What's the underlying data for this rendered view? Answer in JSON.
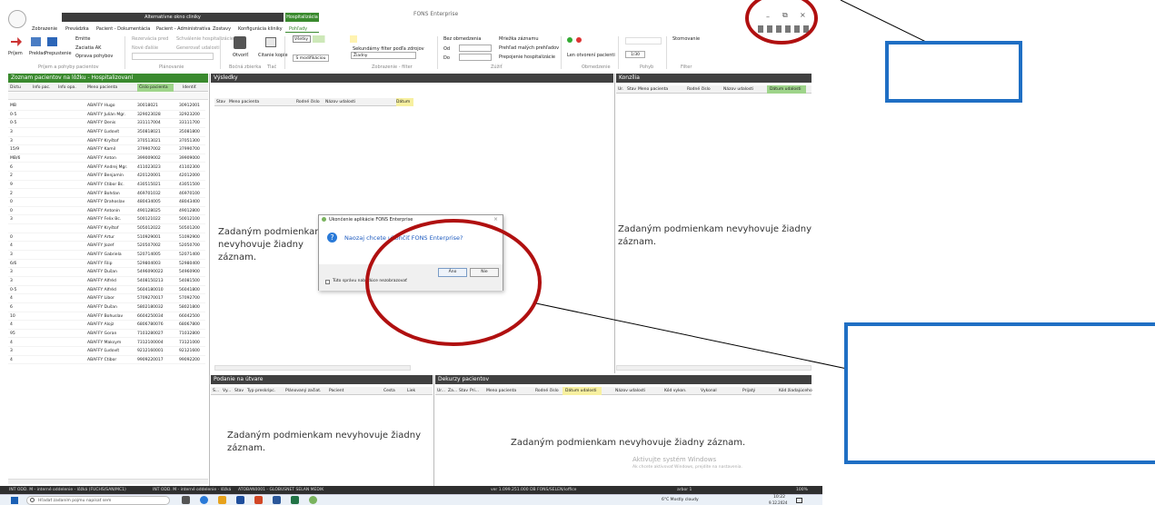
{
  "titlebar": {
    "context_tab": "Alternatívne okno cliniky",
    "contextual_group": "Hospitalizácia",
    "app_title": "FONS Enterprise"
  },
  "menu": [
    "Zobrazenie",
    "Prevádzka",
    "Pacient - Dokumentácia",
    "Pacient - Administratíva",
    "Zostavy",
    "Konfigurácia kliniky",
    "Pohľady"
  ],
  "ribbon": {
    "btns_left": [
      "Príjem",
      "Prekład",
      "Prepustenie"
    ],
    "btn_emitte": "Emitte",
    "btn_zaciatok": "Zaciatia AK",
    "btn_oprava": "Oprava pohybov",
    "grp_prijem": "Príjem a pohyby pacientov",
    "btn_rezervacia": "Rezervácia pred",
    "btn_nove_dalsie": "Nové ďalšie",
    "btn_schvalenie": "Schválenie hospitalizácie",
    "btn_generovat": "Generovať udalosti",
    "grp_planovanie": "Plánovanie",
    "btn_otvorit": "Otvoriť",
    "grp_bocna": "Bočná zbierka",
    "btn_tlacit": "Citanie kopie",
    "grp_tlac": "Tlač",
    "filter_vsetky": "Všetky",
    "lbl_select_filter": "Sekundárny filter podľa zdrojov",
    "filter_zdroj": "Žiadny",
    "btn_modifikacie": "S modifikáciou",
    "grp_zobrazenie": "Zobrazenie - filter",
    "lbl_bez_obmedzenia": "Bez obmedzenia",
    "lbl_od": "Od",
    "lbl_do": "Do",
    "grp_zuzit": "Zúžiť",
    "lbl_mriezka": "Mriežka záznamu",
    "lbl_prehlad": "Prehľad malých prehľadov",
    "lbl_propojenie": "Prepojenie hospitalizácie",
    "lbl_len_otvorene": "Len otvorení pacienti",
    "grp_obmedzenia": "Obmedzenie",
    "page_counter": "1/30",
    "grp_pohyb": "Pohyb",
    "btn_stornovanie": "Stornovanie",
    "grp_filter": "Filter"
  },
  "left_panel": {
    "title": "Zoznam pacientov na lôžku - Hospitalizovaní",
    "columns": [
      "Dictu",
      "Info pac.",
      "Info opa.",
      "Meno pacienta",
      "Číslo pacienta",
      "Identif."
    ],
    "rows": [
      {
        "c0": "MB",
        "name": "ABAFFY Hugo",
        "id": "30018021",
        "id2": "30912001"
      },
      {
        "c0": "0-5",
        "name": "ABAFFY Julián Mgr.",
        "id": "329023028",
        "id2": "32923200"
      },
      {
        "c0": "0-5",
        "name": "ABAFFY Denis",
        "id": "331117004",
        "id2": "33111700"
      },
      {
        "c0": "3",
        "name": "ABAFFY Ľudovít",
        "id": "350818021",
        "id2": "35081800"
      },
      {
        "c0": "3",
        "name": "ABAFFY Kryštof",
        "id": "370513021",
        "id2": "37051300"
      },
      {
        "c0": "15/9",
        "name": "ABAFFY Kamil",
        "id": "379907002",
        "id2": "37990700"
      },
      {
        "c0": "MB/6",
        "name": "ABAFFY Anton",
        "id": "399009002",
        "id2": "39909000"
      },
      {
        "c0": "6",
        "name": "ABAFFY Andrej Mgr.",
        "id": "411023023",
        "id2": "41102300"
      },
      {
        "c0": "2",
        "name": "ABAFFY Benjamín",
        "id": "420120001",
        "id2": "42012000"
      },
      {
        "c0": "9",
        "name": "ABAFFY Ctibor Bc.",
        "id": "430515021",
        "id2": "43051500"
      },
      {
        "c0": "2",
        "name": "ABAFFY Bohdan",
        "id": "469701032",
        "id2": "46970100"
      },
      {
        "c0": "0",
        "name": "ABAFFY Drahoslav",
        "id": "480434005",
        "id2": "48043400"
      },
      {
        "c0": "0",
        "name": "ABAFFY Antonín",
        "id": "490128025",
        "id2": "49012800"
      },
      {
        "c0": "3",
        "name": "ABAFFY Felix Bc.",
        "id": "500121022",
        "id2": "50012100"
      },
      {
        "c0": "",
        "name": "ABAFFY Kryštof",
        "id": "505012022",
        "id2": "50501200"
      },
      {
        "c0": "0",
        "name": "ABAFFY Artur",
        "id": "510929001",
        "id2": "51092900"
      },
      {
        "c0": "4",
        "name": "ABAFFY Jozef",
        "id": "520507002",
        "id2": "52050700"
      },
      {
        "c0": "3",
        "name": "ABAFFY Gabriela",
        "id": "520714005",
        "id2": "52071400"
      },
      {
        "c0": "6/6",
        "name": "ABAFFY Filip",
        "id": "529804003",
        "id2": "52980400"
      },
      {
        "c0": "3",
        "name": "ABAFFY Dušan",
        "id": "5496090022",
        "id2": "54960900"
      },
      {
        "c0": "3",
        "name": "ABAFFY Alfréd",
        "id": "5408150213",
        "id2": "54081500"
      },
      {
        "c0": "0-5",
        "name": "ABAFFY Alfréd",
        "id": "5604180010",
        "id2": "56041800"
      },
      {
        "c0": "4",
        "name": "ABAFFY Libor",
        "id": "5709270017",
        "id2": "57092700"
      },
      {
        "c0": "6",
        "name": "ABAFFY Dušan",
        "id": "5802180032",
        "id2": "58021800"
      },
      {
        "c0": "10",
        "name": "ABAFFY Bohuslav",
        "id": "6604250034",
        "id2": "66042500"
      },
      {
        "c0": "4",
        "name": "ABAFFY Alojz",
        "id": "6806780076",
        "id2": "68067800"
      },
      {
        "c0": "95",
        "name": "ABAFFY Goran",
        "id": "7103280027",
        "id2": "71032800"
      },
      {
        "c0": "4",
        "name": "ABAFFY Maksym",
        "id": "7312100004",
        "id2": "73121000"
      },
      {
        "c0": "3",
        "name": "ABAFFY Ľudovít",
        "id": "9212160001",
        "id2": "92121600"
      },
      {
        "c0": "4",
        "name": "ABAFFY Ctibor",
        "id": "9909220017",
        "id2": "99092200"
      }
    ]
  },
  "results": {
    "title": "Výsledky",
    "columns": [
      "Stav",
      "Meno pacienta",
      "Rodné číslo",
      "Názov udalosti",
      "Dátum"
    ],
    "empty": "Zadaným podmienkam nevyhovuje žiadny záznam."
  },
  "konzilia": {
    "title": "Konzília",
    "columns": [
      "Ur.",
      "Stav",
      "Meno pacienta",
      "Rodné číslo",
      "Názov udalosti",
      "Dátum udalosti"
    ],
    "empty": "Zadaným podmienkam nevyhovuje žiadny záznam."
  },
  "podanie": {
    "title": "Podanie na útvare",
    "columns": [
      "S...",
      "Vy...",
      "Stav",
      "Typ preskripc.",
      "Plánovaný začiat.",
      "Pacient",
      "Cesta",
      "Liek"
    ],
    "empty": "Zadaným podmienkam nevyhovuje žiadny záznam."
  },
  "dekurzy": {
    "title": "Dekurzy pacientov",
    "columns": [
      "Ur...",
      "Za...",
      "Stav",
      "Pri...",
      "Meno pacienta",
      "Rodné číslo",
      "Dátum udalosti",
      "Názov udalosti",
      "Kód vykon.",
      "Vykonal",
      "Prijatý",
      "Kód žiadajúceho"
    ],
    "empty": "Zadaným podmienkam nevyhovuje žiadny záznam."
  },
  "dialog": {
    "title": "Ukončenie aplikácie FONS Enterprise",
    "message": "Naozaj chcete ukončiť FONS Enterprise?",
    "yes": "Áno",
    "no": "Nie",
    "checkbox": "Túto správu nabudúce nezobrazovať"
  },
  "watermark": {
    "line1": "Aktivujte systém Windows",
    "line2": "Ak chcete aktivovať Windows, prejdite na nastavenia."
  },
  "statusbar": {
    "s1": "INT ODD. M - interné oddelenie - lôžká (FUCHS/SAN/MC1)",
    "s2": "INT ODD. M - interné oddelenie - lôžká",
    "s3": "ATOBAN0001 - GLOBUSNET SELAN MEDIK",
    "s4": "ver 1.099.251.000 DB FONS/SELEN/ioffice",
    "user": "arbor 1",
    "zoom": "100%"
  },
  "taskbar": {
    "search": "Hľadať zadaním pojmu napísať sem",
    "weather": "6°C  Mostly cloudy",
    "time": "10:22",
    "date": "9.12.2024"
  },
  "colors": {
    "accent": "#3a8a2e",
    "annotation_red": "#c00000",
    "annotation_blue": "#1f6fc4",
    "panel_header": "#404040"
  }
}
